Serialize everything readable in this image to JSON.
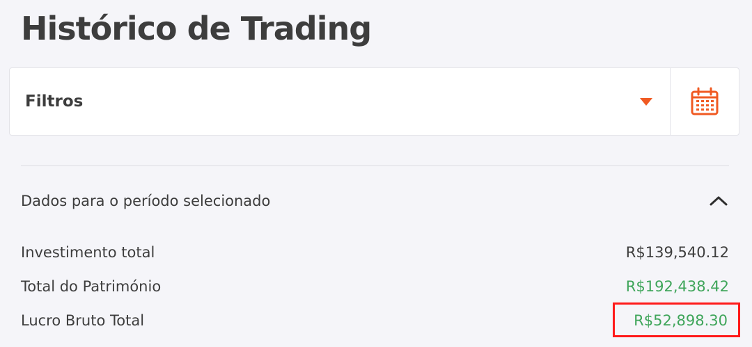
{
  "page": {
    "title": "Histórico de Trading"
  },
  "filters": {
    "label": "Filtros",
    "dropdown_icon": "caret-down-icon",
    "calendar_icon": "calendar-icon"
  },
  "summary": {
    "title": "Dados para o período selecionado",
    "collapse_icon": "chevron-up-icon",
    "rows": [
      {
        "label": "Investimento total",
        "value": "R$139,540.12"
      },
      {
        "label": "Total do Património",
        "value": "R$192,438.42"
      },
      {
        "label": "Lucro Bruto Total",
        "value": "R$52,898.30"
      }
    ]
  },
  "colors": {
    "accent": "#f05a22",
    "positive": "#3fa55a",
    "highlight": "#ff1a1a",
    "text": "#3d3d3d",
    "background": "#f5f5f9"
  }
}
